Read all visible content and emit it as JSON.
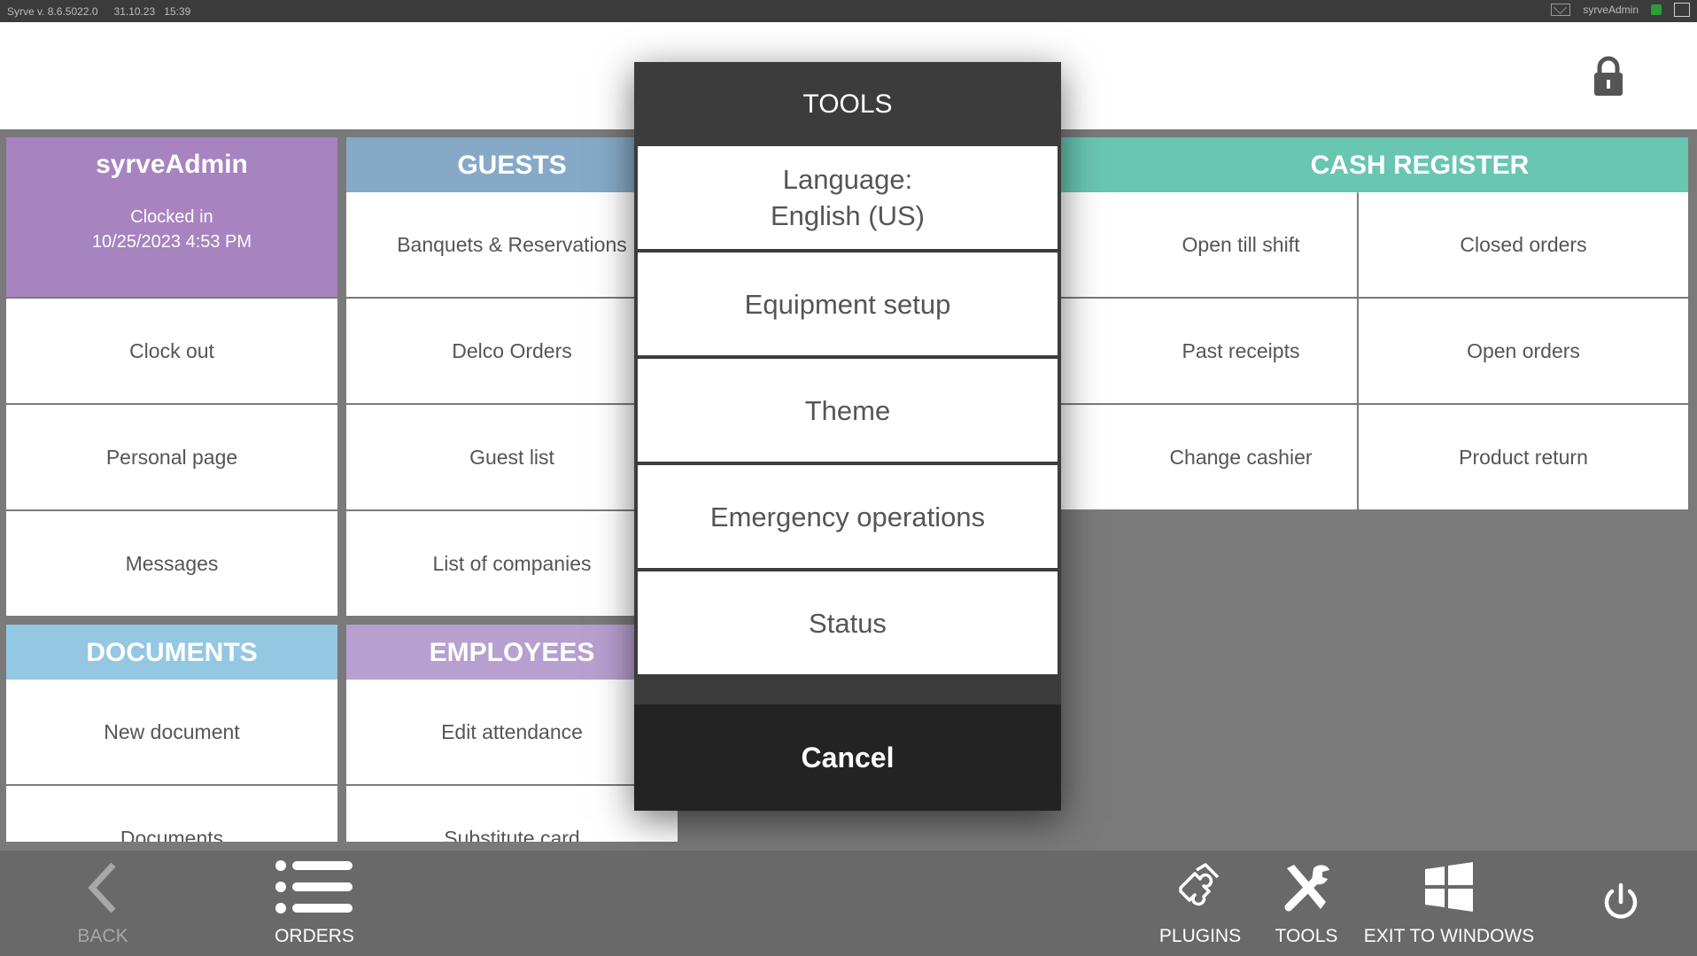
{
  "statusbar": {
    "version": "Syrve v. 8.6.5022.0",
    "date": "31.10.23",
    "time": "15:39",
    "user": "syrveAdmin"
  },
  "user_tile": {
    "name": "syrveAdmin",
    "clocked_label": "Clocked in",
    "clocked_time": "10/25/2023 4:53 PM",
    "items": [
      "Clock out",
      "Personal page",
      "Messages"
    ]
  },
  "guests": {
    "title": "GUESTS",
    "items": [
      "Banquets & Reservations",
      "Delco Orders",
      "Guest list",
      "List of companies"
    ]
  },
  "documents": {
    "title": "DOCUMENTS",
    "items": [
      "New document",
      "Documents"
    ]
  },
  "employees": {
    "title": "EMPLOYEES",
    "items": [
      "Edit attendance",
      "Substitute card"
    ]
  },
  "cash_register": {
    "title": "CASH REGISTER",
    "items": [
      "Open till shift",
      "Closed orders",
      "Past receipts",
      "Open orders",
      "Change cashier",
      "Product return"
    ]
  },
  "modal": {
    "title": "TOOLS",
    "language_line1": "Language:",
    "language_line2": "English (US)",
    "items": [
      "Equipment setup",
      "Theme",
      "Emergency operations",
      "Status"
    ],
    "cancel": "Cancel"
  },
  "bottombar": {
    "back": "BACK",
    "orders": "ORDERS",
    "plugins": "PLUGINS",
    "tools": "TOOLS",
    "exit": "EXIT TO WINDOWS"
  },
  "colors": {
    "user": "#a783c0",
    "guests": "#86a9c8",
    "documents": "#94c7e2",
    "employees": "#b79fd0",
    "cash_register": "#68c6b1"
  }
}
